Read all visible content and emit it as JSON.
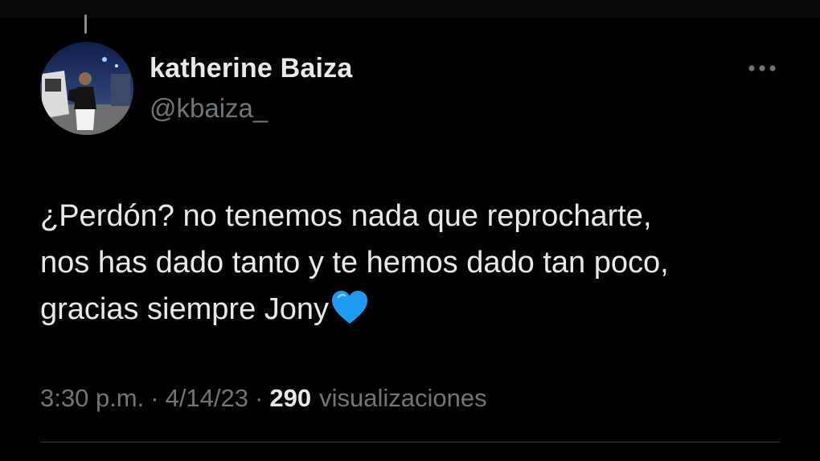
{
  "tweet": {
    "author": {
      "display_name": "katherine Baiza",
      "handle": "@kbaiza_"
    },
    "text": "¿Perdón? no tenemos nada que reprocharte,\nnos has dado tanto y te hemos dado tan poco,\ngracias siempre Jony",
    "emoji": "blue-heart",
    "time": "3:30 p.m.",
    "separator": "·",
    "date": "4/14/23",
    "views_count": "290",
    "views_label": "visualizaciones"
  },
  "colors": {
    "background": "#000000",
    "primary_text": "#e7e9ea",
    "secondary_text": "#71767b",
    "divider": "#2f3336",
    "heart": "#1d9bf0"
  },
  "icons": {
    "more": "more-horizontal-icon",
    "heart": "blue-heart-icon"
  }
}
